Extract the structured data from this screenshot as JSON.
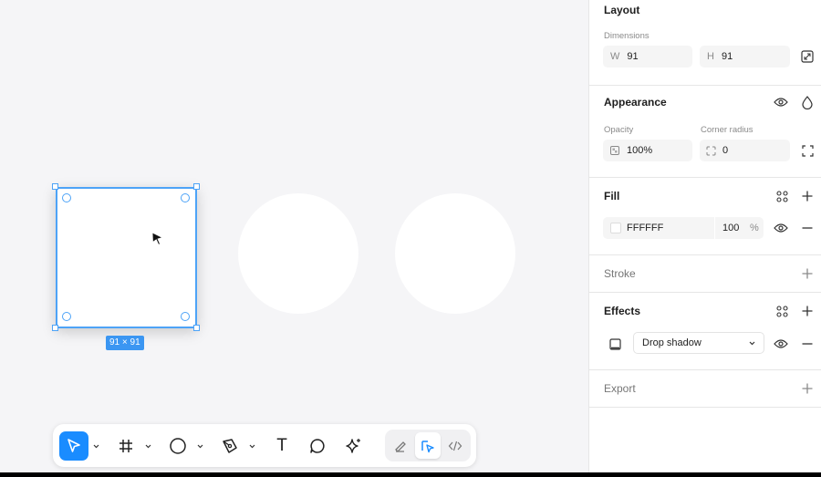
{
  "canvas": {
    "selection_size_label": "91 × 91"
  },
  "toolbar": {
    "tools": [
      "move-tool",
      "frame-tool",
      "shape-tool",
      "pen-tool",
      "text-tool",
      "comment-tool",
      "ai-tool"
    ],
    "active_tool": "move-tool",
    "mode_buttons": [
      "draw-mode",
      "design-mode",
      "dev-mode"
    ],
    "active_mode": "design-mode",
    "text_tool_glyph": "T"
  },
  "panel": {
    "layout": {
      "title": "Layout",
      "dimensions_label": "Dimensions",
      "width_prefix": "W",
      "width_value": "91",
      "height_prefix": "H",
      "height_value": "91"
    },
    "appearance": {
      "title": "Appearance",
      "opacity_label": "Opacity",
      "opacity_value": "100%",
      "corner_radius_label": "Corner radius",
      "corner_radius_value": "0"
    },
    "fill": {
      "title": "Fill",
      "hex": "FFFFFF",
      "opacity": "100",
      "unit": "%",
      "color": "#FFFFFF"
    },
    "stroke": {
      "title": "Stroke"
    },
    "effects": {
      "title": "Effects",
      "effect_type": "Drop shadow"
    },
    "export": {
      "title": "Export"
    }
  },
  "colors": {
    "accent": "#1a8cff",
    "selection": "#4da3f7",
    "canvas_bg": "#f5f5f7"
  }
}
